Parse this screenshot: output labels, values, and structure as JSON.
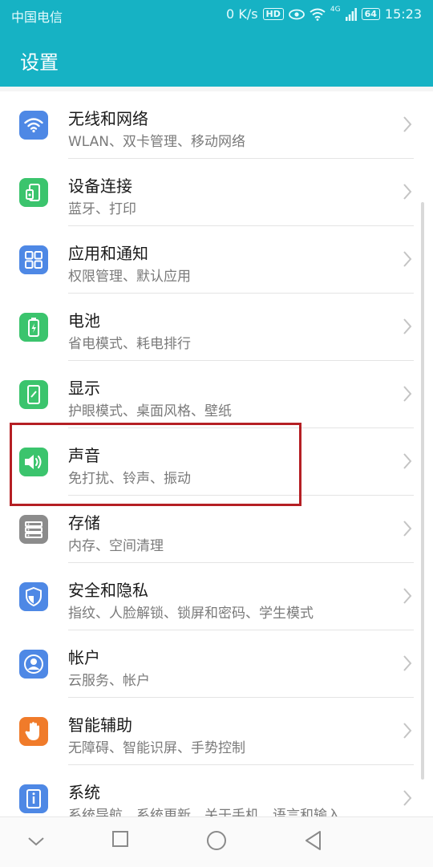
{
  "status_bar": {
    "carrier": "中国电信",
    "speed": "0 K/s",
    "hd": "HD",
    "network": "4G",
    "battery": "64",
    "time": "15:23"
  },
  "header": {
    "title": "设置"
  },
  "settings": [
    {
      "label": "无线和网络",
      "sub": "WLAN、双卡管理、移动网络",
      "icon": "wifi-icon",
      "color": "#4e88e5"
    },
    {
      "label": "设备连接",
      "sub": "蓝牙、打印",
      "icon": "device-connect-icon",
      "color": "#3bc46d"
    },
    {
      "label": "应用和通知",
      "sub": "权限管理、默认应用",
      "icon": "apps-grid-icon",
      "color": "#4e88e5"
    },
    {
      "label": "电池",
      "sub": "省电模式、耗电排行",
      "icon": "battery-icon",
      "color": "#3bc46d"
    },
    {
      "label": "显示",
      "sub": "护眼模式、桌面风格、壁纸",
      "icon": "display-icon",
      "color": "#3bc46d"
    },
    {
      "label": "声音",
      "sub": "免打扰、铃声、振动",
      "icon": "speaker-icon",
      "color": "#3bc46d"
    },
    {
      "label": "存储",
      "sub": "内存、空间清理",
      "icon": "storage-icon",
      "color": "#8c8c8c"
    },
    {
      "label": "安全和隐私",
      "sub": "指纹、人脸解锁、锁屏和密码、学生模式",
      "icon": "shield-icon",
      "color": "#4e88e5"
    },
    {
      "label": "帐户",
      "sub": "云服务、帐户",
      "icon": "account-icon",
      "color": "#4e88e5"
    },
    {
      "label": "智能辅助",
      "sub": "无障碍、智能识屏、手势控制",
      "icon": "hand-icon",
      "color": "#f07b2a"
    },
    {
      "label": "系统",
      "sub": "系统导航、系统更新、关于手机、语言和输入",
      "icon": "system-info-icon",
      "color": "#4e88e5"
    }
  ],
  "colors": {
    "accent": "#16b2c4",
    "highlight": "#b51f24"
  }
}
